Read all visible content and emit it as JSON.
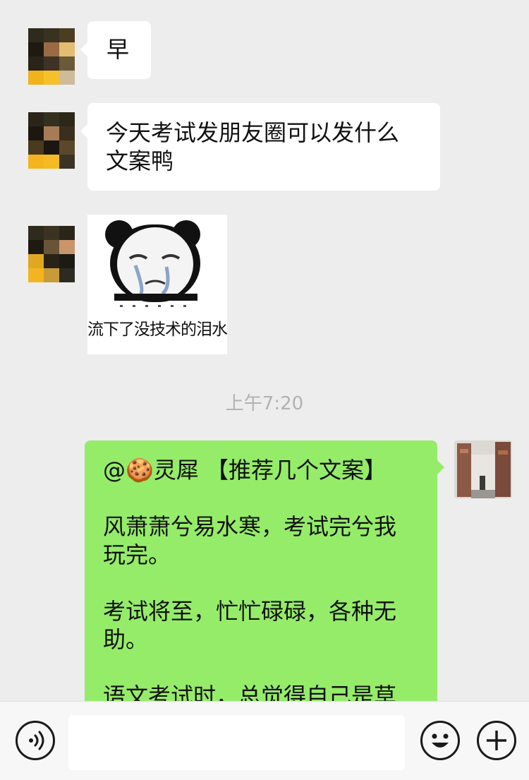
{
  "messages": {
    "m1": "早",
    "m2_line1": "今天考试发朋友圈可以发什么",
    "m2_line2": "文案鸭",
    "sticker_caption": "流下了没技术的泪水"
  },
  "timestamp": "上午7:20",
  "reply": {
    "mention": "@🍪灵犀",
    "title": "【推荐几个文案】",
    "para1_line1": "风萧萧兮易水寒，考试完兮我",
    "para1_line2": "玩完。",
    "para2_line1": "考试将至，忙忙碌碌，各种无",
    "para2_line2": "助。",
    "para3_line1": "语文考试时，总觉得自己是草"
  },
  "icons": {
    "voice": "voice-icon",
    "emoji": "emoji-icon",
    "add": "plus-icon"
  }
}
